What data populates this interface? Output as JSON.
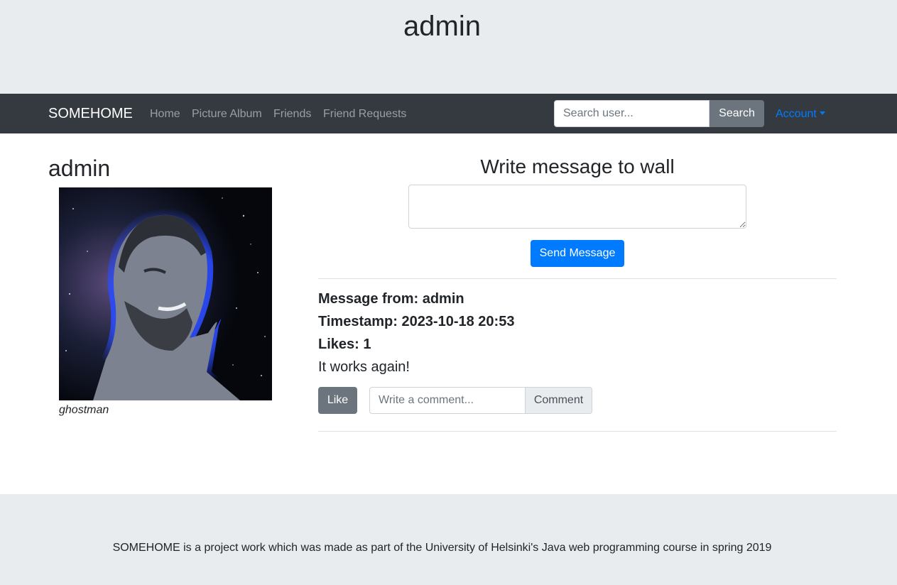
{
  "header": {
    "title": "admin"
  },
  "navbar": {
    "brand": "SOMEHOME",
    "links": [
      "Home",
      "Picture Album",
      "Friends",
      "Friend Requests"
    ],
    "search_placeholder": "Search user...",
    "search_label": "Search",
    "account_label": "Account"
  },
  "profile": {
    "name": "admin",
    "picture_caption": "ghostman"
  },
  "wall": {
    "title": "Write message to wall",
    "message_value": "",
    "send_label": "Send Message"
  },
  "messages": [
    {
      "from_text": "Message from: admin",
      "timestamp_text": "Timestamp: 2023-10-18 20:53",
      "likes_text": "Likes: 1",
      "body": "It works again!",
      "like_label": "Like",
      "comment_placeholder": "Write a comment...",
      "comment_label": "Comment"
    }
  ],
  "footer": {
    "text": "SOMEHOME is a project work which was made as part of the University of Helsinki's Java web programming course in spring 2019"
  },
  "colors": {
    "navbar_bg": "#343a40",
    "jumbotron_bg": "#e9ecef",
    "primary": "#007bff",
    "secondary": "#6c757d"
  }
}
